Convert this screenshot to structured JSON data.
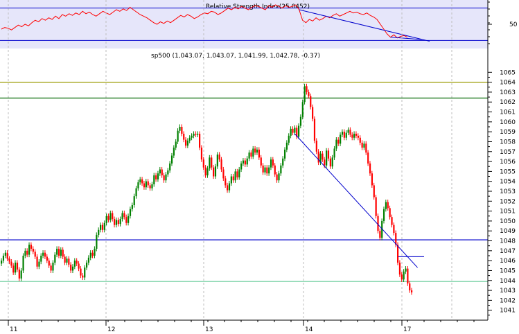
{
  "chart_data": [
    {
      "type": "line",
      "panel": "indicator",
      "title": "Relative Strength Index(25.0452)",
      "ylim": [
        20,
        80
      ],
      "yticks": [
        "50"
      ],
      "reference_lines": [
        70,
        30
      ],
      "colors": {
        "line": "#ff0000",
        "reference": "#0000cc",
        "background": "#e6e6fa"
      },
      "series": [
        {
          "values": [
            44,
            46,
            45,
            43,
            46,
            49,
            47,
            50,
            48,
            52,
            55,
            53,
            57,
            55,
            58,
            56,
            60,
            57,
            62,
            60,
            63,
            61,
            64,
            62,
            66,
            63,
            65,
            62,
            60,
            63,
            66,
            64,
            62,
            65,
            68,
            66,
            69,
            67,
            71,
            68,
            65,
            62,
            60,
            58,
            55,
            52,
            50,
            53,
            51,
            54,
            52,
            55,
            58,
            61,
            59,
            62,
            60,
            57,
            59,
            62,
            64,
            63,
            66,
            65,
            62,
            64,
            67,
            70,
            68,
            71,
            69,
            72,
            70,
            68,
            71,
            73,
            72,
            70,
            68,
            73,
            71,
            74,
            72,
            70,
            73,
            71,
            72,
            74,
            68,
            55,
            52,
            56,
            54,
            58,
            55,
            57,
            60,
            58,
            61,
            63,
            60,
            62,
            64,
            66,
            64,
            65,
            63,
            62,
            64,
            61,
            59,
            56,
            50,
            44,
            38,
            34,
            37,
            33,
            35,
            36,
            34
          ]
        }
      ],
      "trendline": {
        "color": "#0000cc"
      }
    },
    {
      "type": "candlestick",
      "panel": "price",
      "title": "sp500 (1,043.07, 1,043.07, 1,041.99, 1,042.78, -0.37)",
      "ylim": [
        1040,
        1066
      ],
      "yticks": [
        "1041",
        "1042",
        "1043",
        "1044",
        "1045",
        "1046",
        "1047",
        "1048",
        "1049",
        "1050",
        "1051",
        "1052",
        "1053",
        "1054",
        "1055",
        "1056",
        "1057",
        "1058",
        "1059",
        "1060",
        "1061",
        "1062",
        "1063",
        "1064",
        "1065"
      ],
      "xtick_labels": [
        "11",
        "12",
        "13",
        "14",
        "17"
      ],
      "grid": true,
      "colors": {
        "up": "#008000",
        "down": "#ff0000",
        "horizontal": "#0000cc",
        "support": "#66cc99",
        "olive": "#999900",
        "darkgreen": "#006600"
      },
      "horizontal_lines": [
        {
          "value": 1064.0,
          "color": "#999900"
        },
        {
          "value": 1062.4,
          "color": "#006600"
        },
        {
          "value": 1048.1,
          "color": "#0000cc"
        },
        {
          "value": 1043.9,
          "color": "#66cc99"
        }
      ],
      "trendlines": [
        {
          "from_index": 148,
          "from": 1058.8,
          "to_index": 210,
          "to": 1045.3,
          "color": "#0000cc"
        }
      ],
      "days": [
        {
          "label": "11",
          "closes": [
            1046.0,
            1046.5,
            1046.8,
            1046.2,
            1045.9,
            1045.5,
            1044.8,
            1045.8,
            1045.1,
            1044.2,
            1045.0,
            1046.5,
            1047.0,
            1046.6,
            1047.6,
            1047.2,
            1046.9,
            1046.4,
            1045.4,
            1045.9,
            1046.5,
            1046.8,
            1046.4,
            1046.0,
            1045.5,
            1045.0,
            1045.8,
            1046.6,
            1047.2,
            1046.5,
            1047.1,
            1046.4,
            1045.8,
            1046.2,
            1045.6,
            1045.0,
            1045.4,
            1046.0,
            1045.7,
            1045.2,
            1044.5,
            1044.3,
            1045.3,
            1045.8,
            1046.3,
            1046.8,
            1046.5,
            1047.2,
            1048.6,
            1049.1
          ]
        },
        {
          "label": "12",
          "closes": [
            1049.6,
            1049.1,
            1049.8,
            1050.5,
            1050.1,
            1050.8,
            1050.2,
            1049.6,
            1050.1,
            1049.7,
            1050.2,
            1050.8,
            1050.4,
            1049.8,
            1050.5,
            1051.2,
            1051.6,
            1052.5,
            1053.3,
            1053.9,
            1054.2,
            1053.8,
            1053.4,
            1054.0,
            1053.6,
            1053.3,
            1053.7,
            1054.6,
            1054.2,
            1054.8,
            1055.2,
            1054.6,
            1054.1,
            1054.7,
            1055.1,
            1055.8,
            1056.6,
            1057.4,
            1058.0,
            1059.1,
            1059.5,
            1058.8,
            1058.2,
            1057.6,
            1058.1,
            1058.4,
            1058.6,
            1058.8,
            1058.7,
            1058.8
          ]
        },
        {
          "label": "13",
          "closes": [
            1057.4,
            1056.2,
            1055.4,
            1054.6,
            1055.3,
            1056.4,
            1055.4,
            1054.5,
            1055.5,
            1056.7,
            1056.2,
            1055.2,
            1054.3,
            1053.6,
            1053.1,
            1053.8,
            1054.5,
            1054.1,
            1055.0,
            1054.4,
            1055.2,
            1055.8,
            1056.1,
            1055.7,
            1056.3,
            1056.9,
            1056.5,
            1057.3,
            1056.9,
            1057.2,
            1056.4,
            1055.6,
            1054.9,
            1055.4,
            1054.8,
            1055.4,
            1056.2,
            1055.6,
            1054.7,
            1054.1,
            1054.8,
            1055.6,
            1056.3,
            1057.2,
            1057.9,
            1058.6,
            1059.3,
            1058.9,
            1059.4,
            1058.5
          ]
        },
        {
          "label": "14",
          "closes": [
            1059.6,
            1060.5,
            1062.0,
            1063.6,
            1063.0,
            1062.6,
            1061.5,
            1060.3,
            1058.1,
            1057.0,
            1055.9,
            1056.8,
            1056.2,
            1055.6,
            1057.1,
            1056.3,
            1055.5,
            1056.4,
            1057.3,
            1058.2,
            1057.8,
            1058.7,
            1059.0,
            1058.4,
            1058.9,
            1059.2,
            1058.7,
            1058.4,
            1058.8,
            1058.6,
            1058.4,
            1057.9,
            1057.4,
            1057.8,
            1056.9,
            1055.8,
            1054.8,
            1053.6,
            1052.4,
            1050.5,
            1049.0,
            1048.3,
            1050.0,
            1051.2,
            1051.9,
            1051.3,
            1050.4,
            1049.6,
            1048.8,
            1047.6
          ]
        },
        {
          "label": "17",
          "closes": [
            1045.8,
            1044.6,
            1044.1,
            1044.9,
            1045.2,
            1043.7,
            1043.0,
            1042.8
          ]
        }
      ]
    }
  ],
  "labels": {
    "rsi_title": "Relative Strength Index(25.0452)",
    "price_title": "sp500 (1,043.07, 1,043.07, 1,041.99, 1,042.78, -0.37)"
  }
}
